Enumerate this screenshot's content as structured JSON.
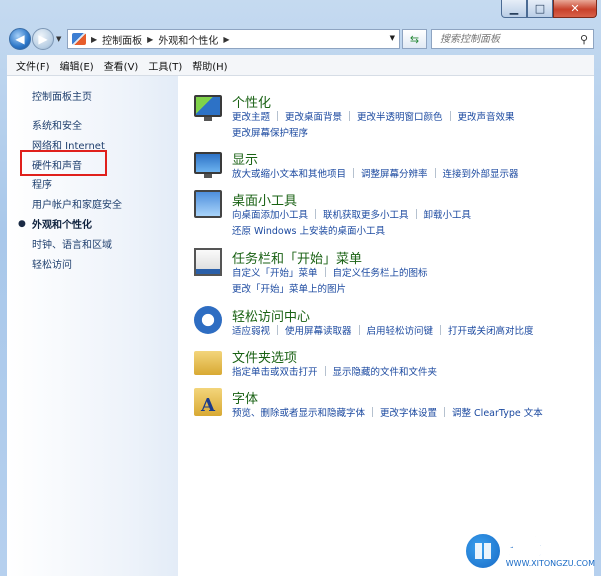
{
  "navigation": {
    "breadcrumb": [
      "控制面板",
      "外观和个性化"
    ],
    "search_placeholder": "搜索控制面板"
  },
  "menu": [
    "文件(F)",
    "编辑(E)",
    "查看(V)",
    "工具(T)",
    "帮助(H)"
  ],
  "sidebar": {
    "items": [
      "控制面板主页",
      "系统和安全",
      "网络和 Internet",
      "硬件和声音",
      "程序",
      "用户帐户和家庭安全",
      "外观和个性化",
      "时钟、语言和区域",
      "轻松访问"
    ],
    "current": "外观和个性化",
    "highlighted": "硬件和声音"
  },
  "categories": [
    {
      "title": "个性化",
      "icon": "personalization-icon",
      "links": [
        "更改主题",
        "更改桌面背景",
        "更改半透明窗口颜色",
        "更改声音效果",
        "更改屏幕保护程序"
      ]
    },
    {
      "title": "显示",
      "icon": "display-icon",
      "links": [
        "放大或缩小文本和其他项目",
        "调整屏幕分辨率",
        "连接到外部显示器"
      ]
    },
    {
      "title": "桌面小工具",
      "icon": "gadgets-icon",
      "links": [
        "向桌面添加小工具",
        "联机获取更多小工具",
        "卸载小工具",
        "还原 Windows 上安装的桌面小工具"
      ]
    },
    {
      "title": "任务栏和「开始」菜单",
      "icon": "taskbar-icon",
      "links": [
        "自定义「开始」菜单",
        "自定义任务栏上的图标",
        "更改「开始」菜单上的图片"
      ]
    },
    {
      "title": "轻松访问中心",
      "icon": "ease-of-access-icon",
      "links": [
        "适应弱视",
        "使用屏幕读取器",
        "启用轻松访问键",
        "打开或关闭高对比度"
      ]
    },
    {
      "title": "文件夹选项",
      "icon": "folder-options-icon",
      "links": [
        "指定单击或双击打开",
        "显示隐藏的文件和文件夹"
      ]
    },
    {
      "title": "字体",
      "icon": "fonts-icon",
      "links": [
        "预览、删除或者显示和隐藏字体",
        "更改字体设置",
        "调整 ClearType 文本"
      ]
    }
  ],
  "watermark": {
    "main": "系统族",
    "sub": "WWW.XITONGZU.COM"
  }
}
